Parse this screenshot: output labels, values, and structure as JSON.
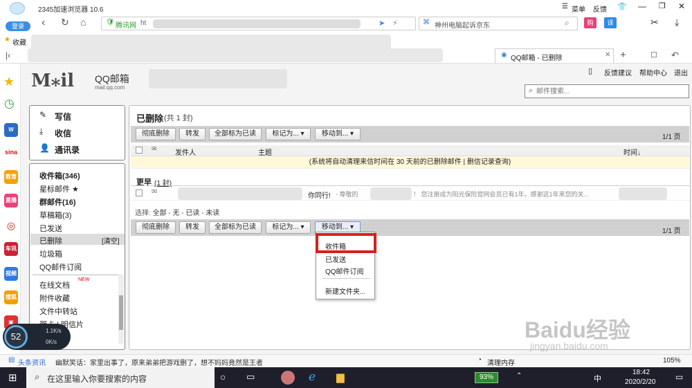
{
  "browser": {
    "title": "2345加速浏览器 10.6",
    "login": "登录",
    "collect": "收藏",
    "menu": "菜单",
    "feedback": "反馈",
    "site_badge": "腾讯网",
    "url_prefix": "ht",
    "search_text": "神州电脑起诉京东",
    "tab_label": "QQ邮箱 - 已删除"
  },
  "mail_header": {
    "logo_text": "QQ邮箱",
    "logo_sub": "mail.qq.com",
    "feedback_link": "反馈建议",
    "help_link": "帮助中心",
    "logout_link": "退出",
    "search_placeholder": "邮件搜索..."
  },
  "nav_top": [
    {
      "label": "写信"
    },
    {
      "label": "收信"
    },
    {
      "label": "通讯录"
    }
  ],
  "folders": [
    {
      "label": "收件箱(346)",
      "bold": true
    },
    {
      "label": "星标邮件 ★"
    },
    {
      "label": "群邮件(16)",
      "bold": true
    },
    {
      "label": "草稿箱(3)"
    },
    {
      "label": "已发送"
    },
    {
      "label": "已删除",
      "selected": true
    },
    {
      "label": "垃圾箱"
    },
    {
      "label": "QQ邮件订阅"
    }
  ],
  "clear_link": "[清空]",
  "extra_folders": [
    {
      "label": "在线文档",
      "badge": "NEW"
    },
    {
      "label": "附件收藏"
    },
    {
      "label": "文件中转站"
    },
    {
      "label": "贺卡 | 明信片"
    }
  ],
  "main": {
    "title": "已删除",
    "count": "(共 1 封)",
    "toolbar_buttons": [
      "彻底删除",
      "转发",
      "全部标为已读",
      "标记为...",
      "移动到..."
    ],
    "pager": "1/1 页",
    "col_sender": "发件人",
    "col_subject": "主题",
    "col_time": "时间↓",
    "notice": "(系统将自动清理来信时间在 30 天前的已删除邮件 | 删信记录查询)",
    "group_label": "更早",
    "group_count": "(1 封)",
    "row_subject": "你同行!",
    "row_preview": "- 尊敬的",
    "row_preview2": "！ 您注册成为阳光保险官网会员已有1年。感谢这1年来您的关...",
    "select_prefix": "选择:",
    "select_all": "全部",
    "select_sep1": "-",
    "select_none": "无",
    "select_sep2": "-",
    "select_read": "已读",
    "select_sep3": "-",
    "select_unread": "未读"
  },
  "move_menu": {
    "items": [
      "收件箱",
      "已发送",
      "QQ邮件订阅"
    ],
    "new_folder": "新建文件夹..."
  },
  "status_bar": {
    "news_label": "头条资讯",
    "news_text": "幽默笑话：家里出事了，原来弟弟把游戏删了，想不妈妈竟然是王者",
    "clean": "清理内存",
    "zoom": "105%"
  },
  "net_widget": {
    "cpu": "52",
    "up": "1.1K/s",
    "down": "0K/s"
  },
  "taskbar": {
    "search_placeholder": "在这里输入你要搜索的内容",
    "battery": "93%",
    "ime": "中",
    "time": "18:42",
    "date": "2020/2/20"
  },
  "watermark": "Baidu经验",
  "watermark_sub": "jingyan.baidu.com"
}
